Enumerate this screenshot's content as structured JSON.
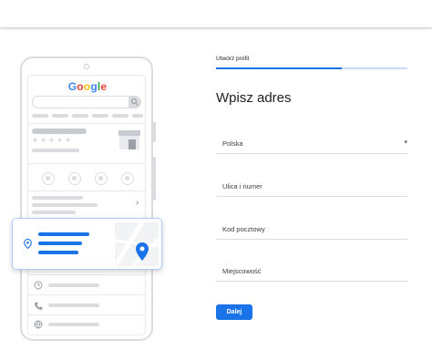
{
  "phone": {
    "logo": {
      "letters": [
        "G",
        "o",
        "o",
        "g",
        "l",
        "e"
      ]
    },
    "rating_stars": [
      "★",
      "★",
      "★",
      "★",
      "★"
    ]
  },
  "form": {
    "tab_label": "Utwórz profil",
    "heading": "Wpisz adres",
    "country": {
      "value": "Polska"
    },
    "street": {
      "placeholder": "Ulica i numer"
    },
    "postal_code": {
      "placeholder": "Kod pocztowy"
    },
    "city": {
      "placeholder": "Miejscowość"
    },
    "next_label": "Dalej"
  },
  "colors": {
    "accent": "#1a73e8",
    "accent_light": "#aecbfa",
    "placeholder_gray": "#dadce0"
  }
}
